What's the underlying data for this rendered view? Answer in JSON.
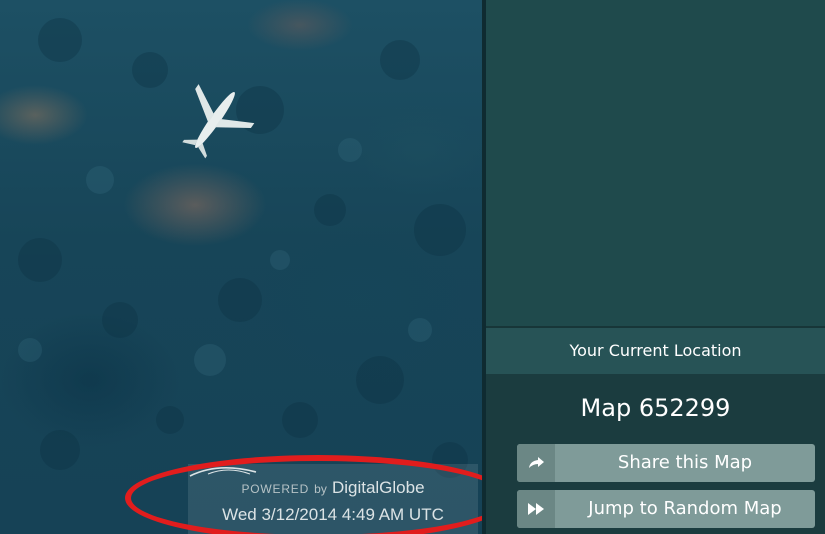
{
  "map_view": {
    "attribution": {
      "powered": "POWERED",
      "by": "by",
      "brand": "DigitalGlobe",
      "timestamp": "Wed 3/12/2014 4:49 AM UTC"
    },
    "annotation_color": "#e11d1d"
  },
  "panel": {
    "location_header": "Your Current Location",
    "map_label": "Map 652299",
    "buttons": [
      {
        "label": "Share this Map",
        "icon": "share-arrow-icon"
      },
      {
        "label": "Jump to Random Map",
        "icon": "fast-forward-icon"
      }
    ]
  },
  "colors": {
    "panel_bg": "#1a3f42",
    "header_bg": "#275356",
    "button_bg": "#7f9b99"
  }
}
